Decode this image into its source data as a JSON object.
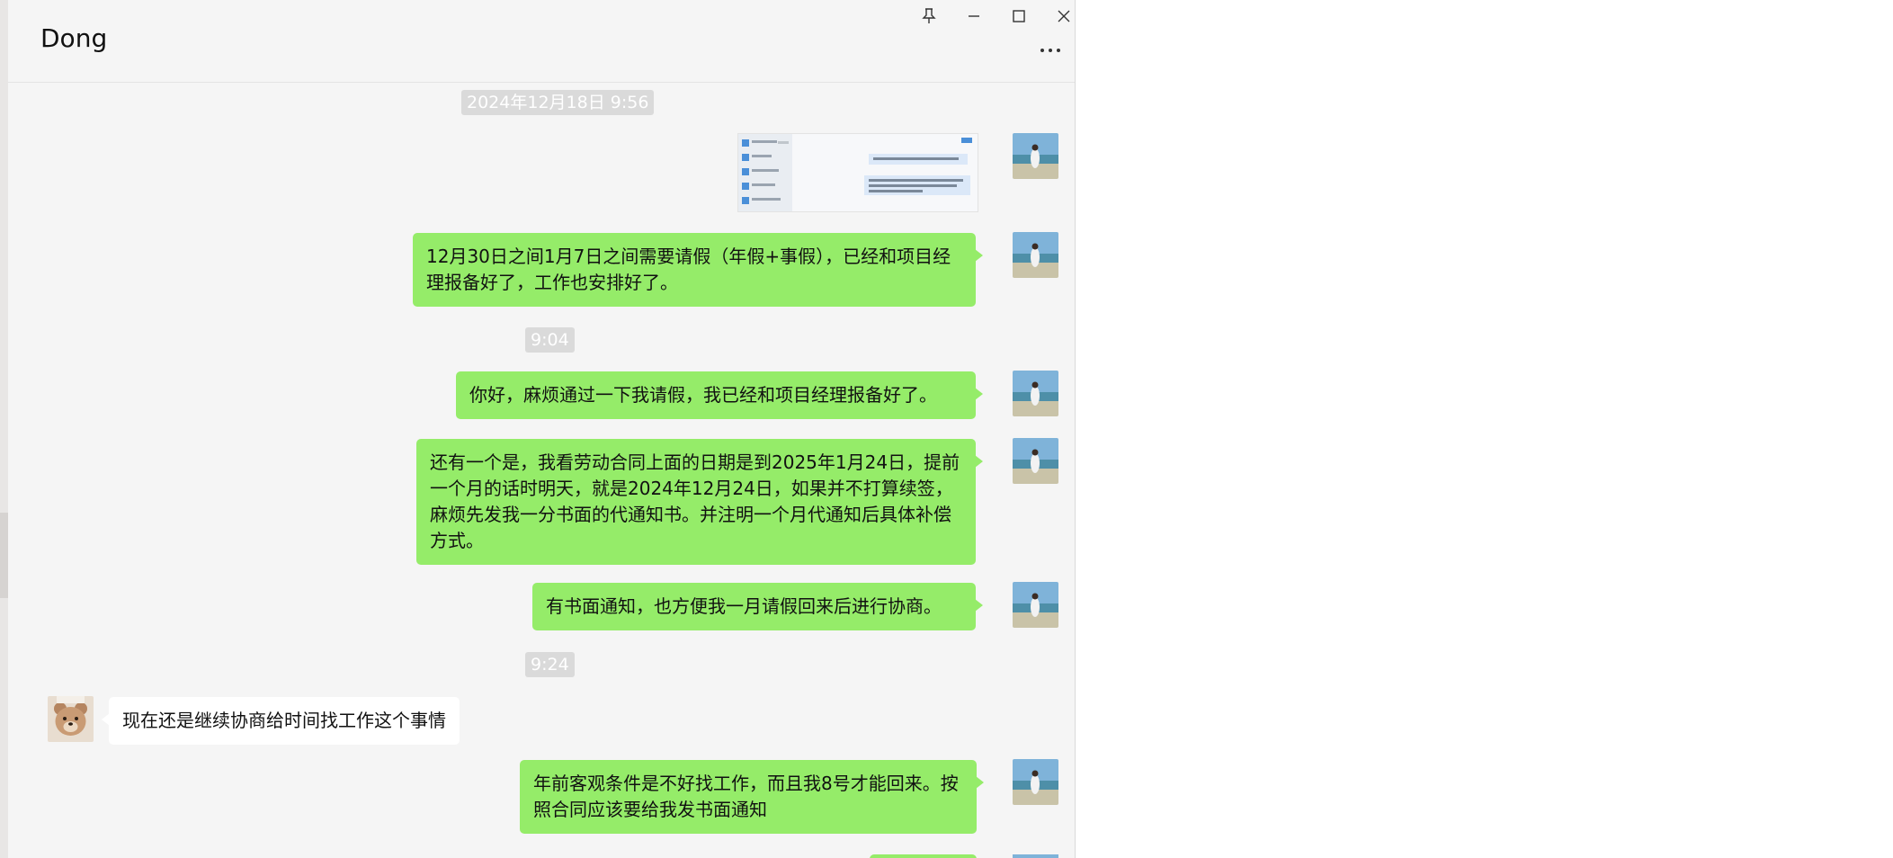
{
  "window": {
    "title": "Dong",
    "controls": [
      "pin-icon",
      "minimize-icon",
      "maximize-icon",
      "close-icon",
      "more-icon"
    ]
  },
  "messages": [
    {
      "type": "time",
      "text": "2024年12月18日 9:56"
    },
    {
      "type": "image",
      "from": "me",
      "content": "screenshot-thumbnail"
    },
    {
      "type": "text",
      "from": "me",
      "text": "12月30日之间1月7日之间需要请假（年假+事假），已经和项目经理报备好了，工作也安排好了。"
    },
    {
      "type": "time",
      "text": "9:04"
    },
    {
      "type": "text",
      "from": "me",
      "text": "你好，麻烦通过一下我请假，我已经和项目经理报备好了。"
    },
    {
      "type": "text",
      "from": "me",
      "text": "还有一个是，我看劳动合同上面的日期是到2025年1月24日，提前一个月的话时明天，就是2024年12月24日，如果并不打算续签，麻烦先发我一分书面的代通知书。并注明一个月代通知后具体补偿方式。"
    },
    {
      "type": "text",
      "from": "me",
      "text": "有书面通知，也方便我一月请假回来后进行协商。"
    },
    {
      "type": "time",
      "text": "9:24"
    },
    {
      "type": "text",
      "from": "them",
      "text": "现在还是继续协商给时间找工作这个事情"
    },
    {
      "type": "text",
      "from": "me",
      "text": "年前客观条件是不好找工作，而且我8号才能回来。按照合同应该要给我发书面通知"
    }
  ],
  "colors": {
    "my_bubble": "#95ec69",
    "their_bubble": "#ffffff",
    "chat_background": "#f5f5f5",
    "timestamp_background": "#dadada"
  }
}
